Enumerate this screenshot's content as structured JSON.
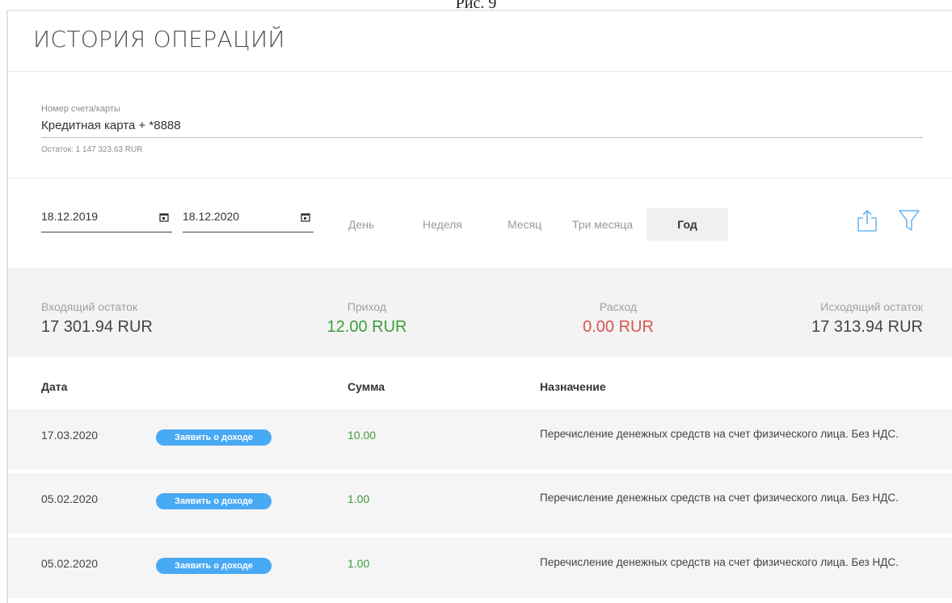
{
  "caption": "Рис. 9",
  "page_title": "ИСТОРИЯ ОПЕРАЦИЙ",
  "account": {
    "label": "Номер счета/карты",
    "value": "Кредитная карта + *8888",
    "balance": "Остаток: 1 147 323.63 RUR"
  },
  "filters": {
    "date_from": "18.12.2019",
    "date_to": "18.12.2020",
    "periods": [
      "День",
      "Неделя",
      "Месяц",
      "Три месяца",
      "Год"
    ],
    "active_period": "Год",
    "icons": [
      "export-icon",
      "filter-icon"
    ]
  },
  "summary": {
    "incoming_label": "Входящий остаток",
    "incoming_value": "17 301.94 RUR",
    "income_label": "Приход",
    "income_value": "12.00 RUR",
    "expense_label": "Расход",
    "expense_value": "0.00 RUR",
    "outgoing_label": "Исходящий остаток",
    "outgoing_value": "17 313.94 RUR"
  },
  "table": {
    "headers": [
      "Дата",
      "Сумма",
      "Назначение"
    ],
    "rows": [
      {
        "date": "17.03.2020",
        "badge": "Заявить о доходе",
        "amount": "10.00",
        "purpose": "Перечисление денежных средств на счет физического лица. Без НДС."
      },
      {
        "date": "05.02.2020",
        "badge": "Заявить о доходе",
        "amount": "1.00",
        "purpose": "Перечисление денежных средств на счет физического лица. Без НДС."
      },
      {
        "date": "05.02.2020",
        "badge": "Заявить о доходе",
        "amount": "1.00",
        "purpose": "Перечисление денежных средств на счет физического лица. Без НДС."
      }
    ]
  },
  "colors": {
    "accent_blue": "#48a9f4",
    "income_green": "#3f9c3a",
    "expense_red": "#d9534f"
  }
}
